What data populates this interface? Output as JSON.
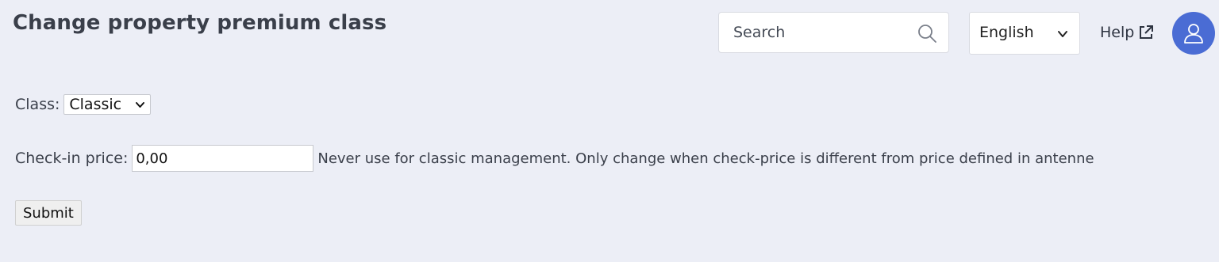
{
  "header": {
    "title": "Change property premium class",
    "search": {
      "placeholder": "Search",
      "value": ""
    },
    "language": {
      "selected": "English"
    },
    "help_label": "Help"
  },
  "form": {
    "class_label": "Class:",
    "class_value": "Classic",
    "checkin_label": "Check-in price:",
    "checkin_value": "0,00",
    "checkin_hint": "Never use for classic management. Only change when check-price is different from price defined in antenne",
    "submit_label": "Submit"
  },
  "colors": {
    "background": "#eceef6",
    "avatar": "#4a6cd4"
  },
  "icons": {
    "search": "search-icon",
    "chevron": "chevron-down-icon",
    "external": "external-link-icon",
    "user": "user-icon"
  }
}
